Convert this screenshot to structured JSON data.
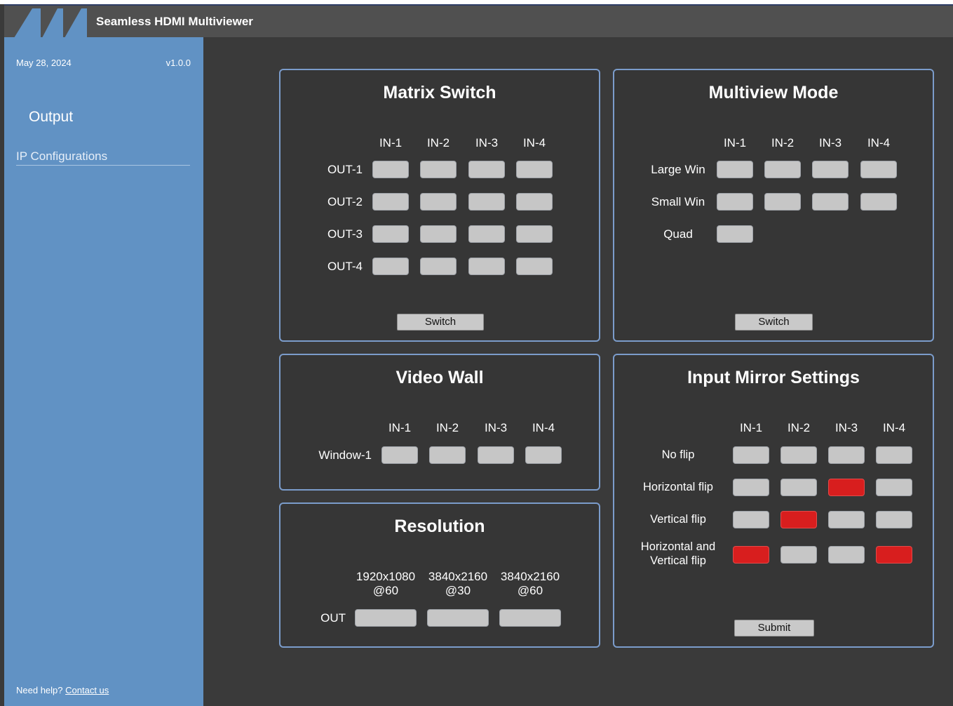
{
  "app": {
    "title": "Seamless HDMI Multiviewer"
  },
  "sidebar": {
    "date": "May 28, 2024",
    "version": "v1.0.0",
    "items": [
      {
        "label": "Output"
      },
      {
        "label": "IP Configurations"
      }
    ],
    "help_text": "Need help?",
    "contact_link": "Contact us"
  },
  "colors": {
    "selected": "#d81e1e",
    "unselected": "#c6c6c6",
    "sidebar": "#6192c4",
    "panel_border": "#7b9ccb"
  },
  "matrix": {
    "title": "Matrix Switch",
    "inputs": [
      "IN-1",
      "IN-2",
      "IN-3",
      "IN-4"
    ],
    "outputs": [
      "OUT-1",
      "OUT-2",
      "OUT-3",
      "OUT-4"
    ],
    "selected": [
      [
        false,
        false,
        false,
        false
      ],
      [
        false,
        false,
        false,
        false
      ],
      [
        false,
        false,
        false,
        false
      ],
      [
        false,
        false,
        false,
        false
      ]
    ],
    "button": "Switch"
  },
  "multiview": {
    "title": "Multiview Mode",
    "inputs": [
      "IN-1",
      "IN-2",
      "IN-3",
      "IN-4"
    ],
    "rows": [
      {
        "label": "Large Win",
        "cells": [
          false,
          false,
          false,
          false
        ]
      },
      {
        "label": "Small Win",
        "cells": [
          false,
          false,
          false,
          false
        ]
      },
      {
        "label": "Quad",
        "cells": [
          false
        ]
      }
    ],
    "button": "Switch"
  },
  "videowall": {
    "title": "Video Wall",
    "inputs": [
      "IN-1",
      "IN-2",
      "IN-3",
      "IN-4"
    ],
    "rows": [
      {
        "label": "Window-1",
        "cells": [
          false,
          false,
          false,
          false
        ]
      }
    ]
  },
  "resolution": {
    "title": "Resolution",
    "options": [
      {
        "res": "1920x1080",
        "rate": "@60"
      },
      {
        "res": "3840x2160",
        "rate": "@30"
      },
      {
        "res": "3840x2160",
        "rate": "@60"
      }
    ],
    "row_label": "OUT",
    "selected": [
      false,
      false,
      false
    ]
  },
  "mirror": {
    "title": "Input Mirror Settings",
    "inputs": [
      "IN-1",
      "IN-2",
      "IN-3",
      "IN-4"
    ],
    "rows": [
      {
        "label": [
          "No flip"
        ],
        "cells": [
          false,
          false,
          false,
          false
        ]
      },
      {
        "label": [
          "Horizontal flip"
        ],
        "cells": [
          false,
          false,
          true,
          false
        ]
      },
      {
        "label": [
          "Vertical flip"
        ],
        "cells": [
          false,
          true,
          false,
          false
        ]
      },
      {
        "label": [
          "Horizontal and",
          "Vertical flip"
        ],
        "cells": [
          true,
          false,
          false,
          true
        ]
      }
    ],
    "button": "Submit"
  }
}
